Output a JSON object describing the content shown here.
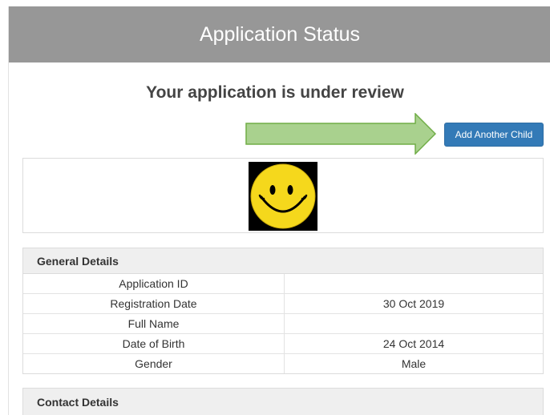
{
  "header": {
    "title": "Application Status"
  },
  "status": {
    "message": "Your application is under review"
  },
  "actions": {
    "add_child_label": "Add Another Child"
  },
  "general_details": {
    "heading": "General Details",
    "rows": [
      {
        "label": "Application ID",
        "value": ""
      },
      {
        "label": "Registration Date",
        "value": "30 Oct 2019"
      },
      {
        "label": "Full Name",
        "value": ""
      },
      {
        "label": "Date of Birth",
        "value": "24 Oct 2014"
      },
      {
        "label": "Gender",
        "value": "Male"
      }
    ]
  },
  "contact_details": {
    "heading": "Contact Details"
  },
  "icons": {
    "photo": "smiley-face-icon",
    "pointer": "right-arrow-icon"
  },
  "colors": {
    "header_bg": "#979797",
    "button_bg": "#337ab7",
    "arrow_fill": "#a9d18e",
    "arrow_stroke": "#70ad47",
    "smiley_yellow": "#f5d81c"
  }
}
